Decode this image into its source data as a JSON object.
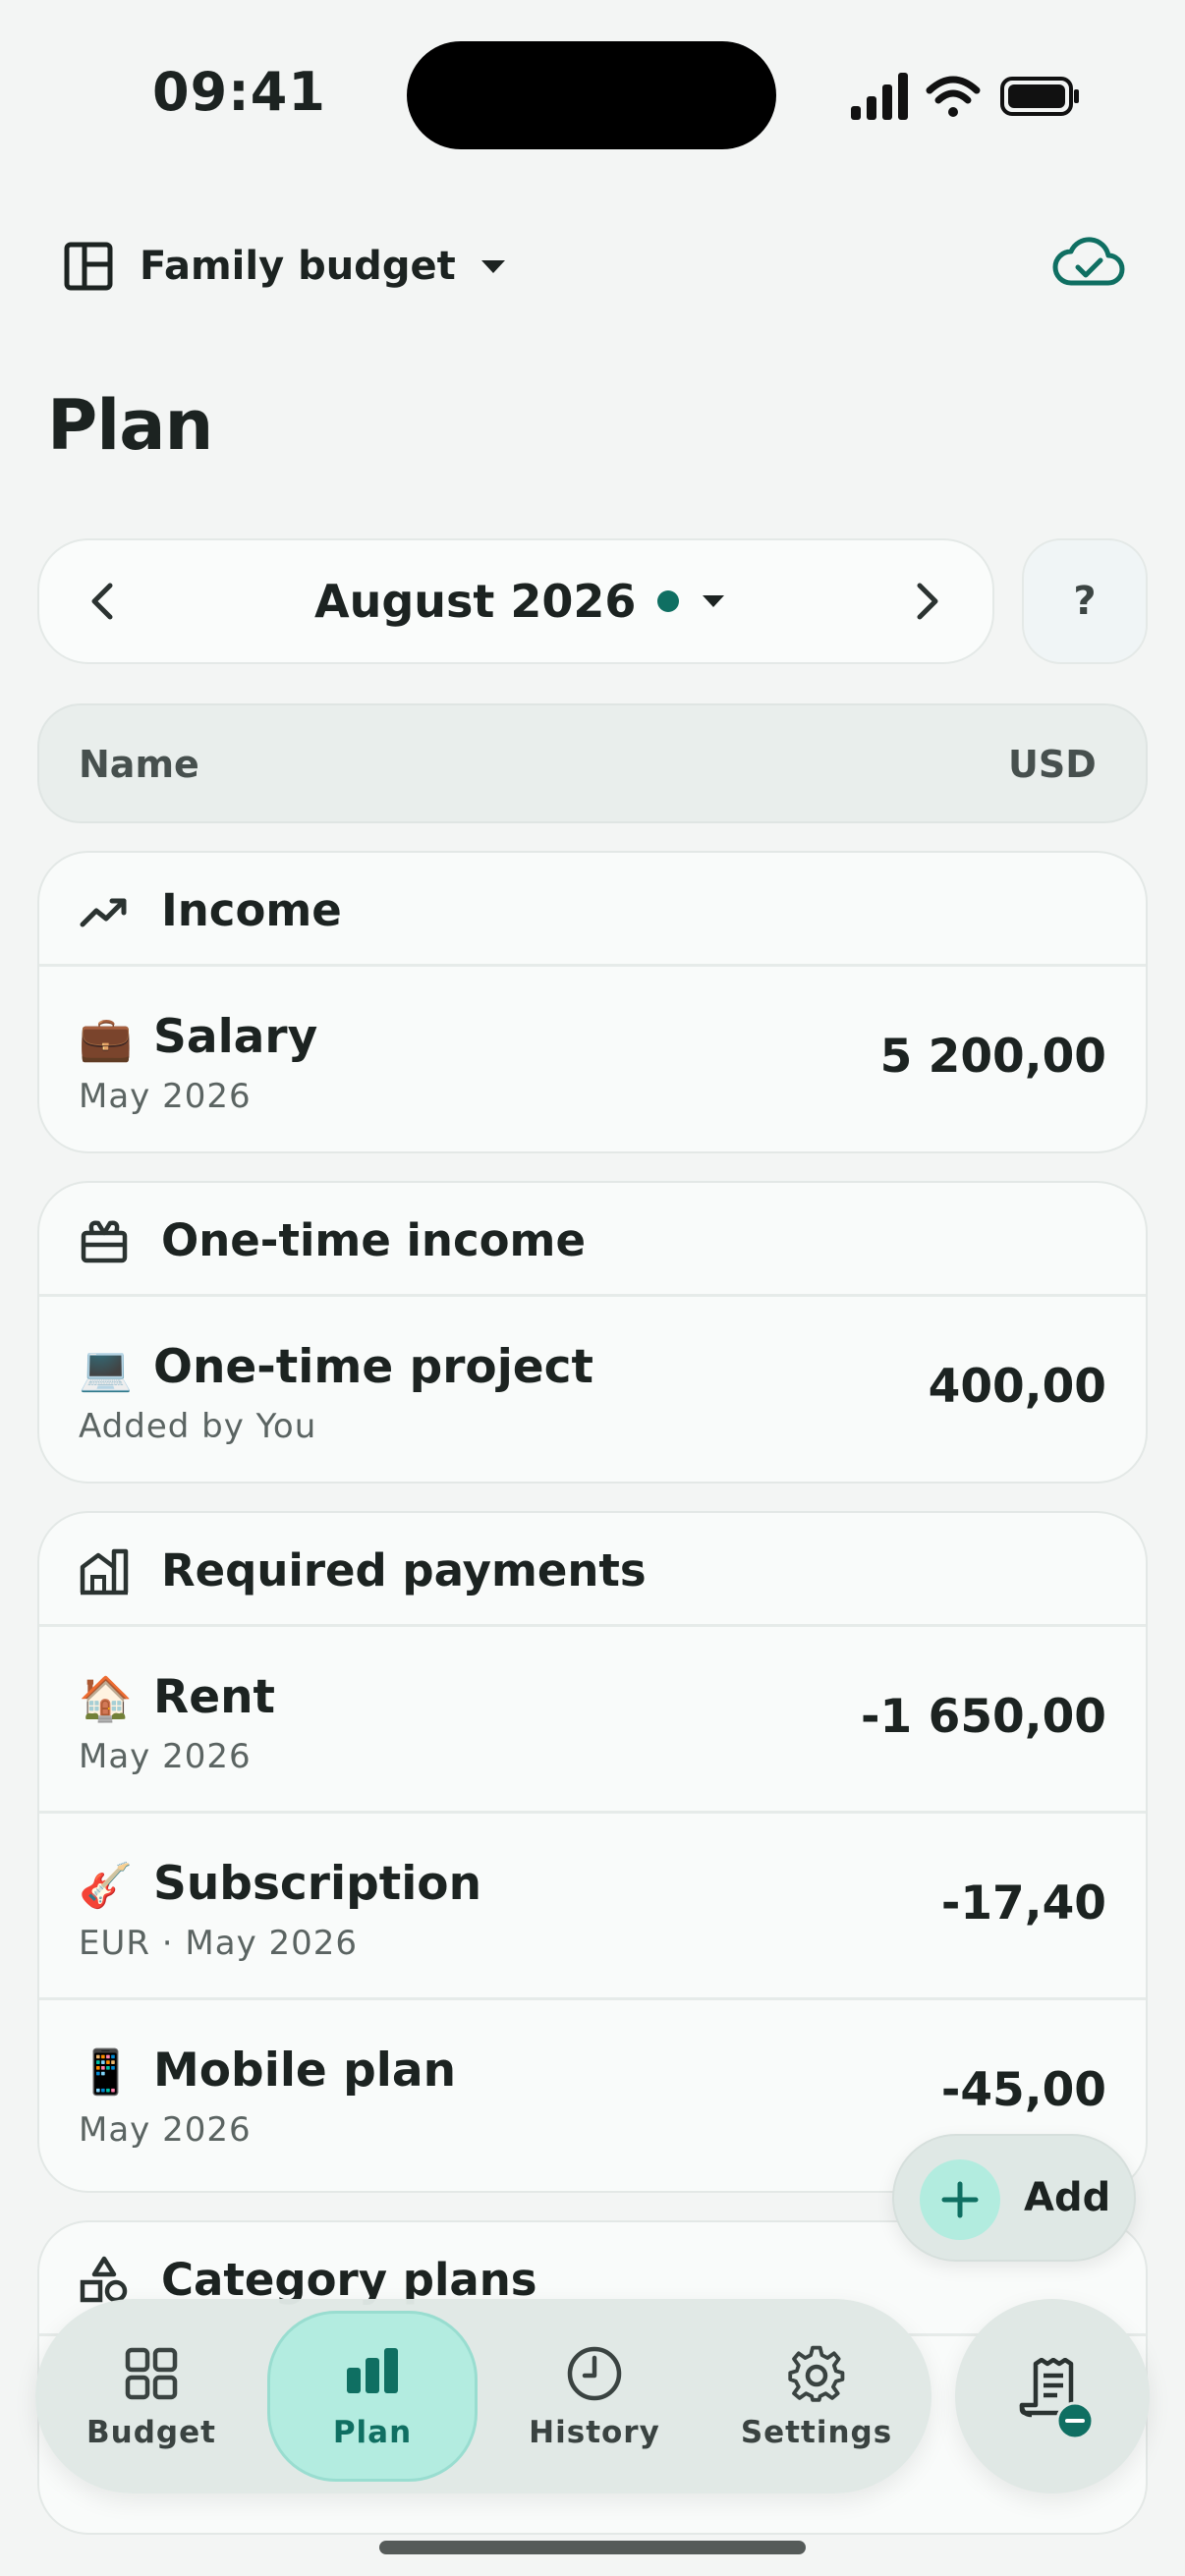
{
  "status_bar": {
    "time": "09:41"
  },
  "header": {
    "budget_name": "Family budget"
  },
  "page": {
    "title": "Plan"
  },
  "month_selector": {
    "label": "August 2026",
    "help_label": "?"
  },
  "table_header": {
    "name_col": "Name",
    "currency_col": "USD"
  },
  "groups": [
    {
      "title": "Income",
      "icon": "trending-up-icon",
      "rows": [
        {
          "emoji": "💼",
          "name": "Salary",
          "sub": "May 2026",
          "amount": "5 200,00"
        }
      ]
    },
    {
      "title": "One-time income",
      "icon": "gift-icon",
      "rows": [
        {
          "emoji": "💻",
          "name": "One-time project",
          "sub": "Added by You",
          "amount": "400,00"
        }
      ]
    },
    {
      "title": "Required payments",
      "icon": "building-icon",
      "rows": [
        {
          "emoji": "🏠",
          "name": "Rent",
          "sub": "May 2026",
          "amount": "-1 650,00"
        },
        {
          "emoji": "🎸",
          "name": "Subscription",
          "sub": "EUR · May 2026",
          "amount": "-17,40"
        },
        {
          "emoji": "📱",
          "name": "Mobile plan",
          "sub": "May 2026",
          "amount": "-45,00"
        }
      ]
    },
    {
      "title": "Category plans",
      "icon": "shapes-icon",
      "rows": []
    }
  ],
  "add_button": {
    "label": "Add"
  },
  "bottom_nav": {
    "items": [
      {
        "label": "Budget",
        "icon": "grid-icon"
      },
      {
        "label": "Plan",
        "icon": "bar-chart-icon",
        "active": true
      },
      {
        "label": "History",
        "icon": "clock-icon"
      },
      {
        "label": "Settings",
        "icon": "gear-icon"
      }
    ]
  },
  "colors": {
    "accent": "#0f6f62",
    "accent_light": "#b3ece0",
    "background": "#f3f5f4"
  }
}
